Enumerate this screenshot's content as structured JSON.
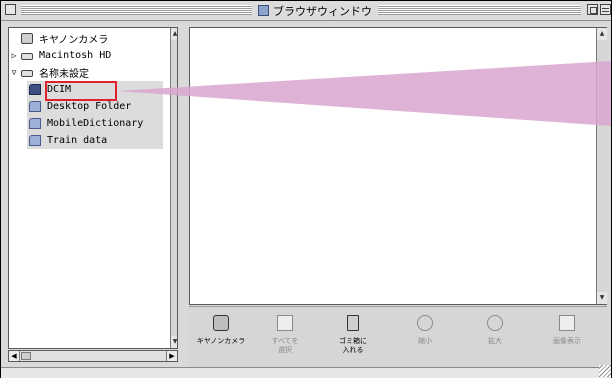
{
  "window": {
    "title": "ブラウザウィンドウ"
  },
  "tree": {
    "items": [
      {
        "label": "キヤノンカメラ",
        "icon": "camera-icon",
        "expanded": null
      },
      {
        "label": "Macintosh HD",
        "icon": "hard-disk-icon",
        "expanded": false
      },
      {
        "label": "名称未設定",
        "icon": "disk-icon",
        "expanded": true
      },
      {
        "label": "DCIM",
        "icon": "folder-icon",
        "expanded": null
      },
      {
        "label": "Desktop Folder",
        "icon": "folder-icon",
        "expanded": null
      },
      {
        "label": "MobileDictionary",
        "icon": "folder-icon",
        "expanded": null
      },
      {
        "label": "Train data",
        "icon": "folder-icon",
        "expanded": null
      }
    ]
  },
  "toolbar": {
    "buttons": [
      {
        "label": "キヤノンカメラ",
        "icon": "camera-icon",
        "enabled": true
      },
      {
        "label": "すべてを\n選択",
        "icon": "select-all-icon",
        "enabled": false
      },
      {
        "label": "ゴミ箱に\n入れる",
        "icon": "trash-icon",
        "enabled": true
      },
      {
        "label": "縮小",
        "icon": "zoom-out-icon",
        "enabled": false
      },
      {
        "label": "拡大",
        "icon": "zoom-in-icon",
        "enabled": false
      },
      {
        "label": "画像表示",
        "icon": "image-view-icon",
        "enabled": false
      }
    ]
  },
  "colors": {
    "highlight_box": "#e0202a",
    "callout": "#d9a6cf"
  }
}
